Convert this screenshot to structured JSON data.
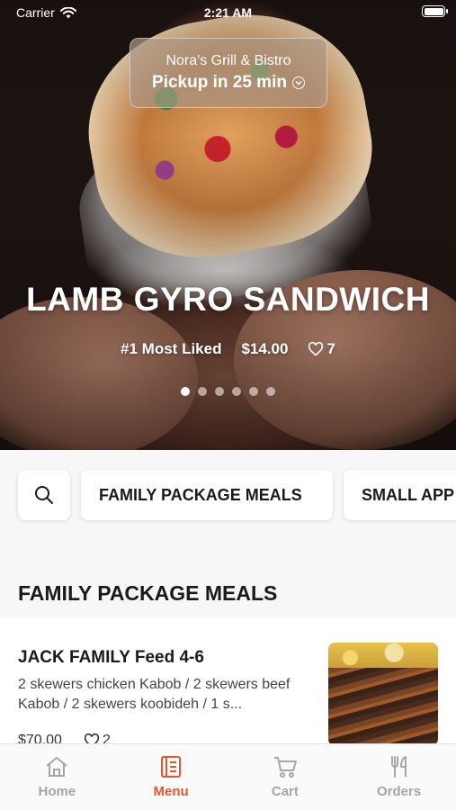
{
  "status_bar": {
    "carrier": "Carrier",
    "time": "2:21 AM"
  },
  "store": {
    "name": "Nora's Grill & Bistro",
    "pickup": "Pickup in 25 min"
  },
  "hero": {
    "title": "LAMB GYRO SANDWICH",
    "badge": "#1 Most Liked",
    "price": "$14.00",
    "likes": "7",
    "dots_count": 6,
    "active_dot": 0
  },
  "categories": [
    "FAMILY PACKAGE MEALS",
    "SMALL APP"
  ],
  "section_title": "FAMILY PACKAGE MEALS",
  "item": {
    "name": "JACK FAMILY Feed 4-6",
    "description": "2 skewers chicken Kabob / 2 skewers beef Kabob / 2 skewers koobideh / 1 s...",
    "price": "$70.00",
    "likes": "2"
  },
  "tabs": [
    {
      "label": "Home",
      "icon": "home-icon"
    },
    {
      "label": "Menu",
      "icon": "menu-icon"
    },
    {
      "label": "Cart",
      "icon": "cart-icon"
    },
    {
      "label": "Orders",
      "icon": "orders-icon"
    }
  ],
  "colors": {
    "accent": "#e4572e",
    "inactive": "#a6a6a6"
  }
}
